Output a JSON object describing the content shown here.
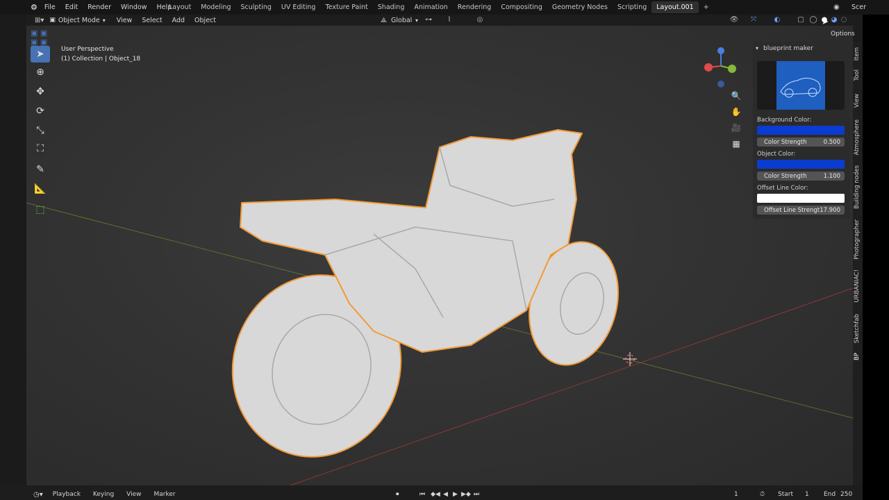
{
  "topbar": {
    "menus": [
      "File",
      "Edit",
      "Render",
      "Window",
      "Help"
    ],
    "tabs": [
      "Layout",
      "Modeling",
      "Sculpting",
      "UV Editing",
      "Texture Paint",
      "Shading",
      "Animation",
      "Rendering",
      "Compositing",
      "Geometry Nodes",
      "Scripting",
      "Layout.001"
    ],
    "add_tab": "+",
    "scene": "Scer"
  },
  "header": {
    "mode": "Object Mode",
    "menus": [
      "View",
      "Select",
      "Add",
      "Object"
    ],
    "transform": "Global",
    "options": "Options"
  },
  "viewport": {
    "perspective": "User Perspective",
    "collection": "(1) Collection | Object_18"
  },
  "npanel": {
    "title": "blueprint maker",
    "bg_color_label": "Background Color:",
    "bg_color": "#0a3ccf",
    "color_strength_label": "Color Strength",
    "color_strength_1": "0.500",
    "object_color_label": "Object Color:",
    "object_color": "#0a3ccf",
    "color_strength_2": "1.100",
    "offset_color_label": "Offset Line Color:",
    "offset_color": "#ffffff",
    "offset_strength_label": "Offset Line Strengt",
    "offset_strength": "17.900"
  },
  "sidebar_tabs": [
    "Item",
    "Tool",
    "View",
    "Atmosphere",
    "Building nodes",
    "Photographer",
    "URBANIAC!",
    "Sketchfab",
    "BP"
  ],
  "timeline": {
    "menus": [
      "Playback",
      "Keying",
      "View",
      "Marker"
    ],
    "current_frame": "1",
    "start_label": "Start",
    "start": "1",
    "end_label": "End",
    "end": "250"
  },
  "colors": {
    "accent": "#4772b3",
    "selection_outline": "#f29a36"
  }
}
